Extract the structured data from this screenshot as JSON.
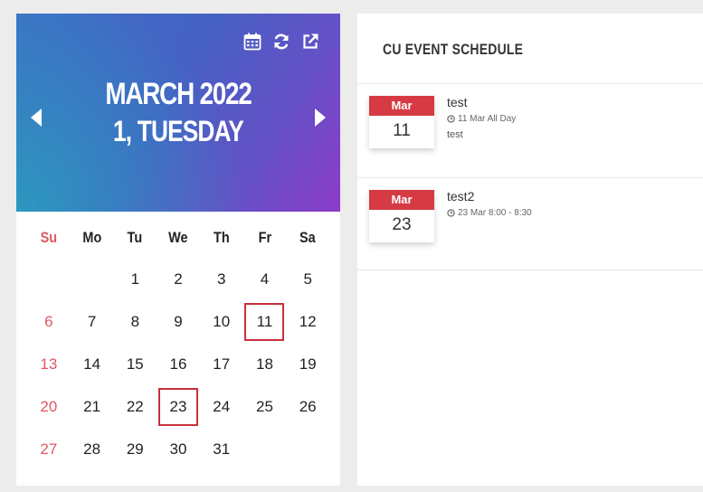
{
  "calendar": {
    "month_year": "MARCH 2022",
    "selected_day": "1, TUESDAY",
    "icons": [
      "calendar-icon",
      "refresh-icon",
      "external-link-icon"
    ],
    "weekdays": [
      "Su",
      "Mo",
      "Tu",
      "We",
      "Th",
      "Fr",
      "Sa"
    ],
    "weeks": [
      [
        "",
        "",
        "1",
        "2",
        "3",
        "4",
        "5"
      ],
      [
        "6",
        "7",
        "8",
        "9",
        "10",
        "11",
        "12"
      ],
      [
        "13",
        "14",
        "15",
        "16",
        "17",
        "18",
        "19"
      ],
      [
        "20",
        "21",
        "22",
        "23",
        "24",
        "25",
        "26"
      ],
      [
        "27",
        "28",
        "29",
        "30",
        "31",
        "",
        ""
      ]
    ],
    "marked_days": [
      "11",
      "23"
    ],
    "accent_color": "#c8303b",
    "sunday_color": "#e05762"
  },
  "schedule": {
    "title": "CU EVENT SCHEDULE",
    "events": [
      {
        "month": "Mar",
        "day": "11",
        "title": "test",
        "time": "11 Mar All Day",
        "description": "test"
      },
      {
        "month": "Mar",
        "day": "23",
        "title": "test2",
        "time": "23 Mar 8:00 - 8:30",
        "description": ""
      }
    ],
    "badge_color": "#d63a43"
  }
}
